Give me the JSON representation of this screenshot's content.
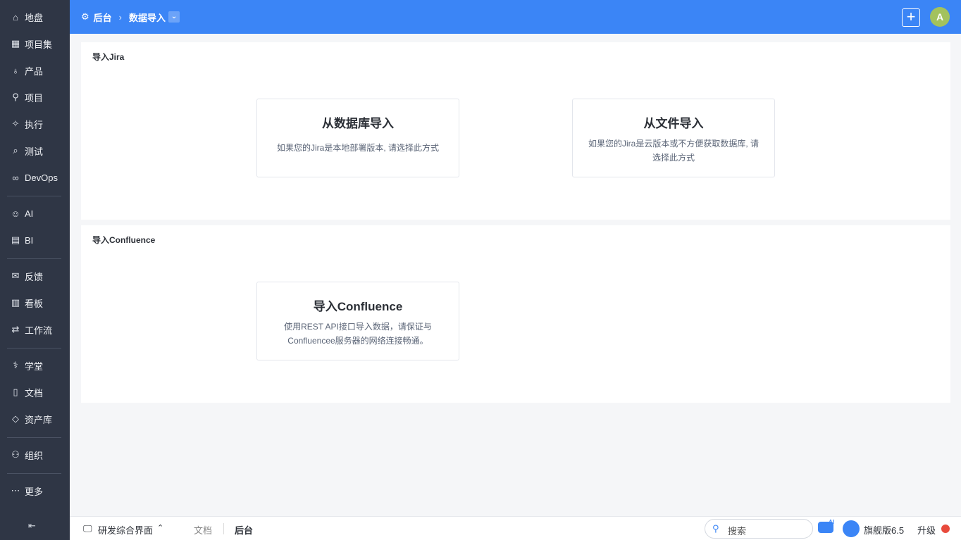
{
  "sidebar": {
    "items": [
      {
        "label": "地盘",
        "icon": "home-icon"
      },
      {
        "label": "项目集",
        "icon": "grid-icon"
      },
      {
        "label": "产品",
        "icon": "bulb-icon"
      },
      {
        "label": "项目",
        "icon": "rocket-icon"
      },
      {
        "label": "执行",
        "icon": "wand-icon"
      },
      {
        "label": "测试",
        "icon": "search-icon"
      },
      {
        "label": "DevOps",
        "icon": "infinity-icon"
      },
      {
        "label": "AI",
        "icon": "robot-icon"
      },
      {
        "label": "BI",
        "icon": "chart-icon"
      },
      {
        "label": "反馈",
        "icon": "inbox-icon"
      },
      {
        "label": "看板",
        "icon": "kanban-icon"
      },
      {
        "label": "工作流",
        "icon": "flow-icon"
      },
      {
        "label": "学堂",
        "icon": "stethoscope-icon"
      },
      {
        "label": "文档",
        "icon": "doc-icon"
      },
      {
        "label": "资产库",
        "icon": "diamond-icon"
      },
      {
        "label": "组织",
        "icon": "users-icon"
      },
      {
        "label": "更多",
        "icon": "more-icon"
      }
    ]
  },
  "header": {
    "root": "后台",
    "current": "数据导入"
  },
  "jira": {
    "title": "导入Jira",
    "cards": [
      {
        "title": "从数据库导入",
        "desc": "如果您的Jira是本地部署版本, 请选择此方式"
      },
      {
        "title": "从文件导入",
        "desc": "如果您的Jira是云版本或不方便获取数据库, 请选择此方式"
      }
    ]
  },
  "confluence": {
    "title": "导入Confluence",
    "card": {
      "title": "导入Confluence",
      "desc": "使用REST API接口导入数据，请保证与Confluencee服务器的网络连接畅通。"
    }
  },
  "bottom": {
    "workspace": "研发综合界面",
    "tab1": "文档",
    "tab2": "后台",
    "search_placeholder": "搜索",
    "ai": "AI",
    "edition": "旗舰版6.5",
    "upgrade": "升级"
  },
  "avatar": "A"
}
